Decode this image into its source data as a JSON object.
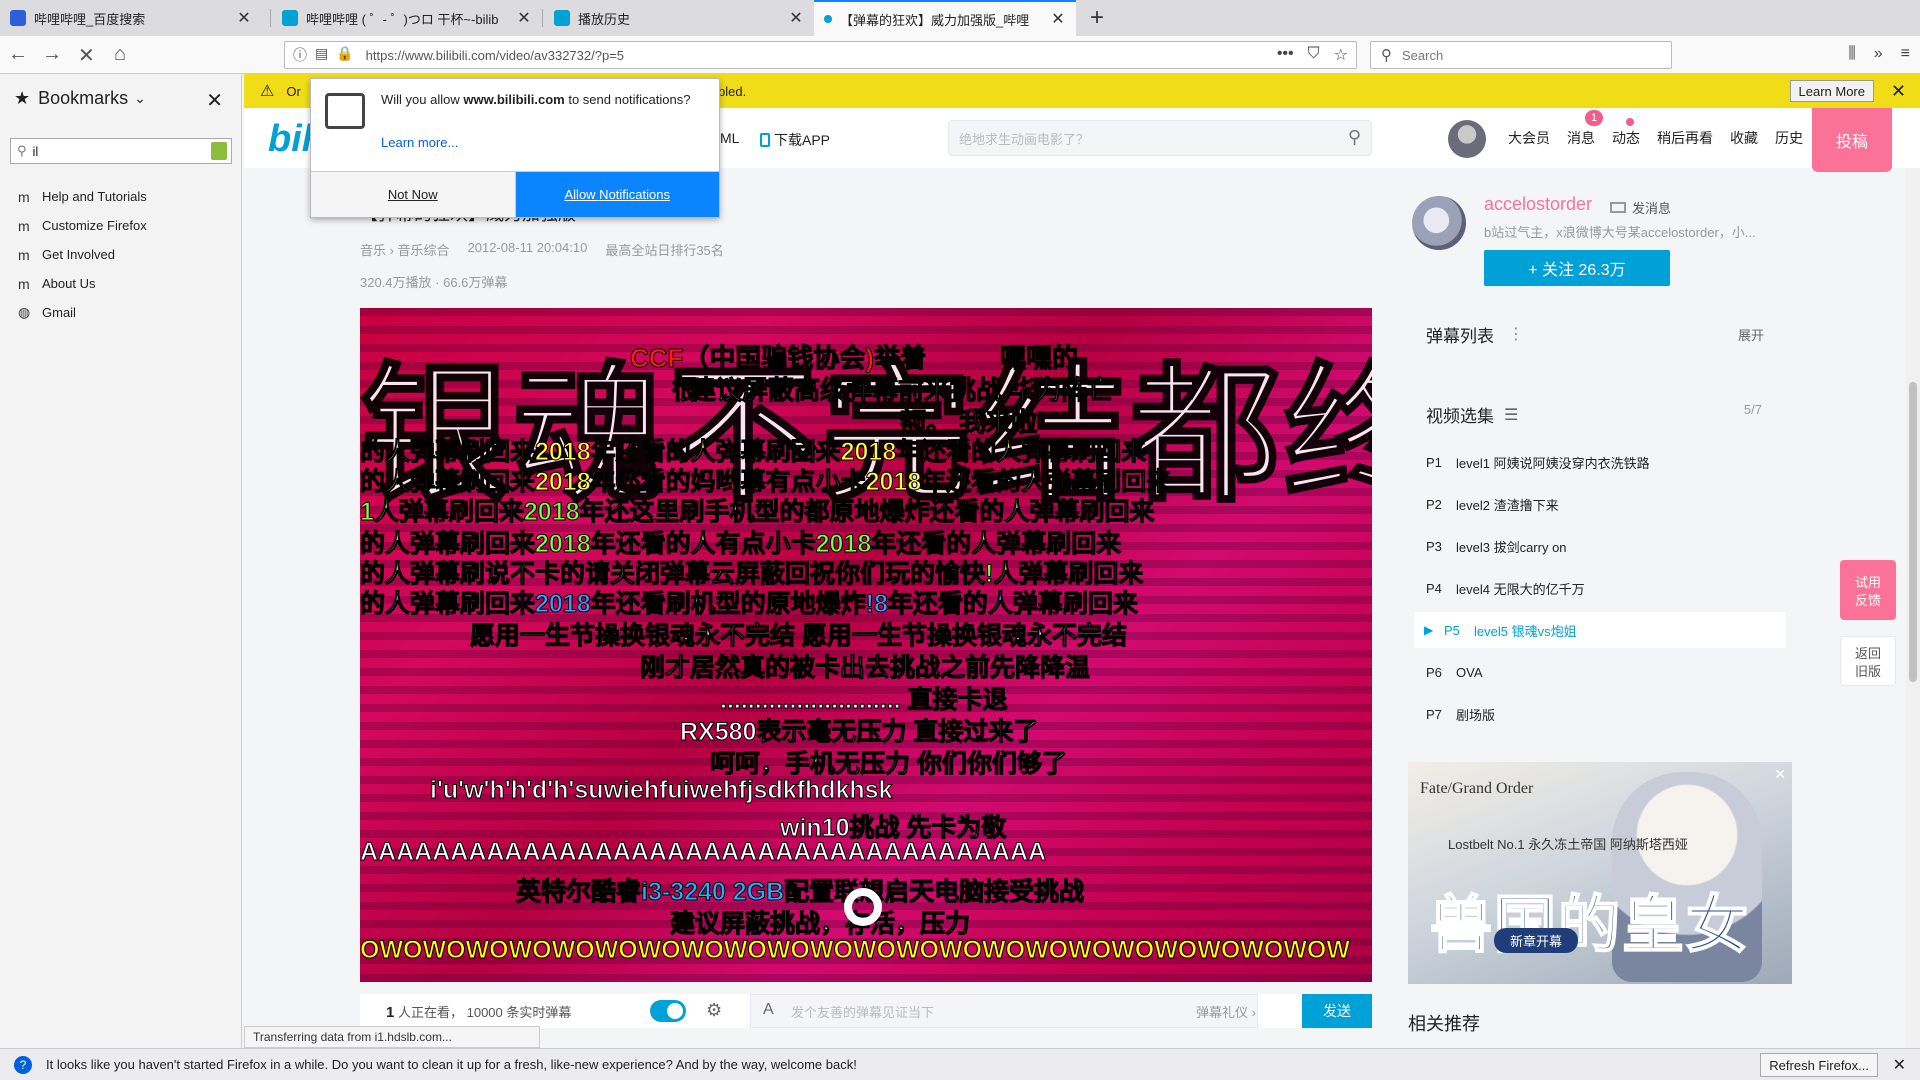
{
  "browser": {
    "tabs": [
      {
        "title": "哔哩哔哩_百度搜索",
        "favicon_color": "#2f5fd8"
      },
      {
        "title": "哔哩哔哩 ( ゜- ゜)つロ 干杯~-bilib",
        "favicon_color": "#00a1d6"
      },
      {
        "title": "播放历史",
        "favicon_color": "#00a1d6"
      },
      {
        "title": "【弹幕的狂欢】威力加强版_哔哩",
        "favicon_color": "#00a1d6"
      }
    ],
    "new_tab": "+",
    "url": "https://www.bilibili.com/video/av332732/?p=5",
    "search_placeholder": "Search",
    "notification_bar": {
      "message_left": "Or",
      "message_right": "bled.",
      "learn_more": "Learn More"
    }
  },
  "sidebar": {
    "title": "Bookmarks",
    "search_value": "il",
    "items": [
      {
        "label": "Help and Tutorials",
        "icon": "mozilla-icon"
      },
      {
        "label": "Customize Firefox",
        "icon": "mozilla-icon"
      },
      {
        "label": "Get Involved",
        "icon": "mozilla-icon"
      },
      {
        "label": "About Us",
        "icon": "mozilla-icon"
      },
      {
        "label": "Gmail",
        "icon": "globe-icon"
      }
    ]
  },
  "permission_popup": {
    "question_prefix": "Will you allow ",
    "domain": "www.bilibili.com",
    "question_suffix": " to send notifications?",
    "learn_more": "Learn more...",
    "not_now": "Not Now",
    "allow": "Allow Notifications"
  },
  "bili_header": {
    "logo": "bili",
    "nav_ml": "ML",
    "app_label": "下载APP",
    "search_placeholder": "绝地求生动画电影了？",
    "nav": [
      "大会员",
      "消息",
      "动态",
      "稍后再看",
      "收藏",
      "历史"
    ],
    "message_badge": "1",
    "upload": "投稿"
  },
  "video": {
    "title": "【弹幕的狂欢】威力加强版",
    "category": "音乐 › 音乐综合",
    "date": "2012-08-11 20:04:10",
    "rank": "最高全站日排行35名",
    "stats": "320.4万播放 · 66.6万弹幕",
    "watching_count": "1",
    "watching_label": "人正在看，",
    "realtime": "10000 条实时弹幕",
    "danmaku_placeholder": "发个友善的弹幕见证当下",
    "danmaku_etiquette": "弹幕礼仪 ›",
    "send": "发送"
  },
  "danmaku_overlay": {
    "big": "银魂不完结都终",
    "lines": [
      {
        "text": "CCF（中国骗钱协会)举着",
        "color": "#ff1a1a"
      },
      {
        "text": "嘿嘿的",
        "color": "#ffffff"
      },
      {
        "text": "建议屏蔽高级弹幕前来挑战  华为阵亡",
        "color": "#ffffff"
      },
      {
        "text": "很",
        "color": "#ffff00"
      },
      {
        "text": "额。  我来啦",
        "color": "#ffffff"
      },
      {
        "text": "的人弹幕刷回来2018年还看的人弹幕刷回来2018年还看的人弹幕刷回来",
        "color": "#ffff33"
      },
      {
        "text": "的人弹幕刷回来2018年还看的妈哟幕有点小卡2018年还看的人弹幕刷回来",
        "color": "#ffff33"
      },
      {
        "text": "1人弹幕刷回来2018年还这里刷手机型的都原地爆炸还看的人弹幕刷回来",
        "color": "#7dff3a"
      },
      {
        "text": "的人弹幕刷回来2018年还看的人有点小卡2018年还看的人弹幕刷回来",
        "color": "#7dff3a"
      },
      {
        "text": "的人弹幕刷说不卡的请关闭弹幕云屏蔽回祝你们玩的愉快!人弹幕刷回来",
        "color": "#7dff3a"
      },
      {
        "text": "的人弹幕刷回来2018年还看刷机型的原地爆炸!8年还看的人弹幕刷回来",
        "color": "#3aa0ff"
      },
      {
        "text": "愿用一生节操换银魂永不完结 愿用一生节操换银魂永不完结",
        "color": "#ffffff"
      },
      {
        "text": "刚才居然真的被卡出去挑战之前先降降温",
        "color": "#ffffff"
      },
      {
        "text": "..........................    直接卡退",
        "color": "#ffffff"
      },
      {
        "text": "RX580表示毫无压力          直接过来了",
        "color": "#ffffff"
      },
      {
        "text": "呵呵，手机无压力          你们你们够了",
        "color": "#ffffff"
      },
      {
        "text": "i'u'w'h'h'd'h'suwiehfuiwehfjsdkfhdkhsk",
        "color": "#ffffff"
      },
      {
        "text": "win10挑战                    先卡为敬",
        "color": "#ffffff"
      },
      {
        "text": "AAAAAAAAAAAAAAAAAAAAAAAAAAAAAAAAAAAAAA",
        "color": "#ffffff"
      },
      {
        "text": "英特尔酷睿i3-3240 2GB配置联想启天电脑接受挑战",
        "color": "#1ab4ff"
      },
      {
        "text": "建议屏蔽挑战，存活，压力",
        "color": "#ffff00"
      },
      {
        "text": "OWOWOWOWOWOWOWOWOWOWOWOWOWOWOWOWOWOWOWOWOWOWOW",
        "color": "#ffff00"
      }
    ]
  },
  "uploader": {
    "name": "accelostorder",
    "send_message": "发消息",
    "desc": "b站过气主，x浪微博大号某accelostorder，小...",
    "follow": "+ 关注 26.3万"
  },
  "danmaku_list": {
    "title": "弹幕列表",
    "expand": "展开"
  },
  "episodes": {
    "title": "视频选集",
    "count": "5/7",
    "items": [
      {
        "num": "P1",
        "title": "level1 阿姨说阿姨没穿内衣洗铁路"
      },
      {
        "num": "P2",
        "title": "level2 渣渣撸下来"
      },
      {
        "num": "P3",
        "title": "level3 拔剑carry on"
      },
      {
        "num": "P4",
        "title": "level4 无限大的亿千万"
      },
      {
        "num": "P5",
        "title": "level5 银魂vs炮姐"
      },
      {
        "num": "P6",
        "title": "OVA"
      },
      {
        "num": "P7",
        "title": "剧场版"
      }
    ],
    "active_index": 4
  },
  "ad": {
    "brand": "Fate/Grand Order",
    "subtitle": "Lostbelt No.1 永久冻土帝国 阿纳斯塔西娅",
    "title": "兽国的皇女",
    "badge": "新章开幕"
  },
  "related": "相关推荐",
  "float": {
    "try": [
      "试用",
      "反馈"
    ],
    "back": [
      "返回",
      "旧版"
    ]
  },
  "status_overlay": "Transferring data from i1.hdslb.com...",
  "bottom_bar": {
    "message": "It looks like you haven't started Firefox in a while. Do you want to clean it up for a fresh, like-new experience? And by the way, welcome back!",
    "refresh": "Refresh Firefox..."
  },
  "colors": {
    "bili_blue": "#00a1d6",
    "bili_pink": "#fb7299",
    "firefox_blue": "#0a84ff"
  }
}
